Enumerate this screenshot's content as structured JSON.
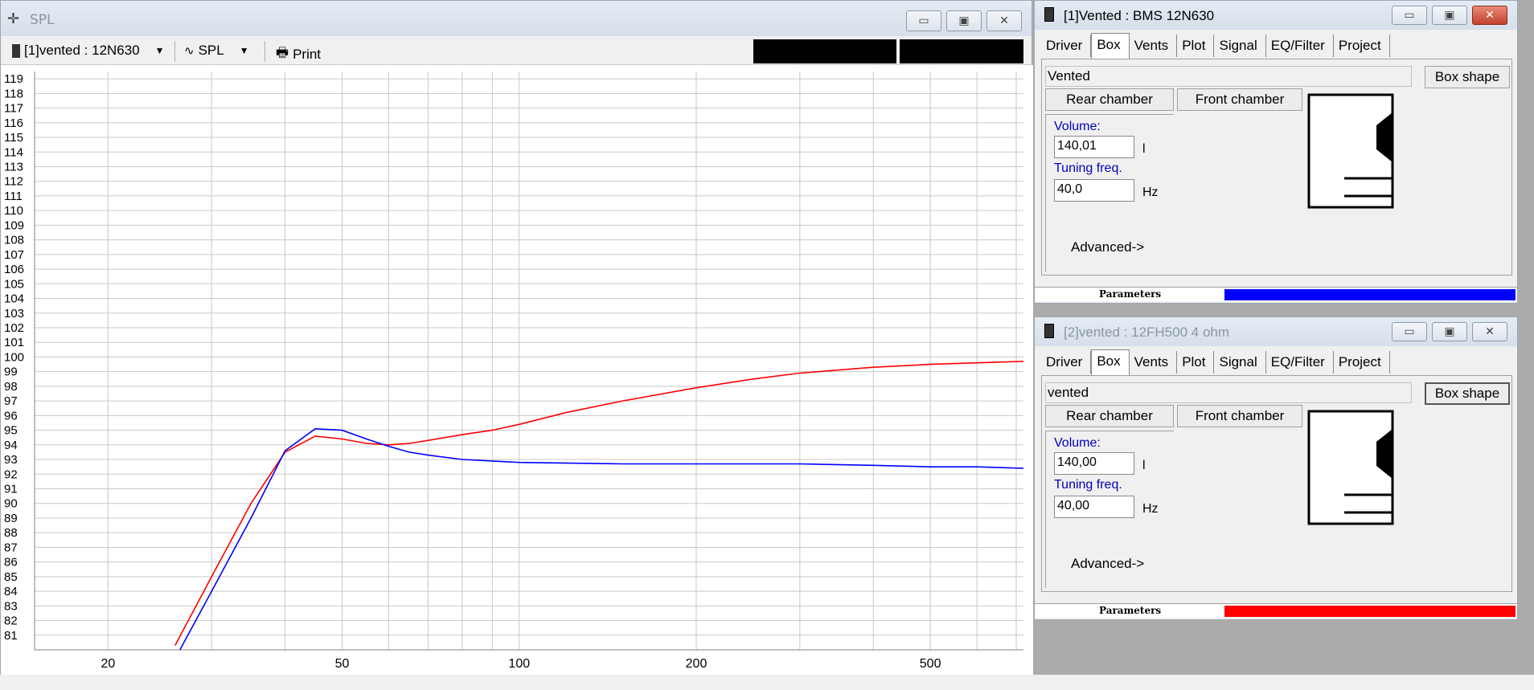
{
  "spl_window": {
    "title": "SPL",
    "toolbar": {
      "driver_select": "[1]vented : 12N630",
      "graph_select": "SPL",
      "print_label": "Print"
    }
  },
  "chart_data": {
    "type": "line",
    "xscale": "log",
    "xlim": [
      15,
      720
    ],
    "ylim": [
      80,
      119.5
    ],
    "x_tick_labels": [
      "20",
      "50",
      "100",
      "200",
      "500"
    ],
    "x_ticks": [
      20,
      50,
      100,
      200,
      500
    ],
    "y_tick_labels": [
      "81",
      "82",
      "83",
      "84",
      "85",
      "86",
      "87",
      "88",
      "89",
      "90",
      "91",
      "92",
      "93",
      "94",
      "95",
      "96",
      "97",
      "98",
      "99",
      "100",
      "101",
      "102",
      "103",
      "104",
      "105",
      "106",
      "107",
      "108",
      "109",
      "110",
      "111",
      "112",
      "113",
      "114",
      "115",
      "116",
      "117",
      "118",
      "119"
    ],
    "grid": true,
    "series": [
      {
        "color": "#ff0000",
        "x": [
          26,
          30,
          35,
          40,
          45,
          50,
          55,
          60,
          65,
          70,
          80,
          90,
          100,
          120,
          150,
          200,
          250,
          300,
          400,
          500,
          600,
          720
        ],
        "y": [
          80.3,
          85.0,
          90.0,
          93.5,
          94.6,
          94.4,
          94.1,
          94.0,
          94.1,
          94.3,
          94.7,
          95.0,
          95.4,
          96.2,
          97.0,
          97.9,
          98.5,
          98.9,
          99.3,
          99.5,
          99.6,
          99.7
        ]
      },
      {
        "color": "#0000ff",
        "x": [
          26.5,
          30,
          35,
          40,
          45,
          50,
          55,
          60,
          65,
          70,
          80,
          90,
          100,
          150,
          200,
          300,
          400,
          500,
          600,
          720
        ],
        "y": [
          80.0,
          84.0,
          89.0,
          93.6,
          95.1,
          95.0,
          94.4,
          93.9,
          93.5,
          93.3,
          93.0,
          92.9,
          92.8,
          92.7,
          92.7,
          92.7,
          92.6,
          92.5,
          92.5,
          92.4
        ]
      }
    ]
  },
  "panel1": {
    "title": "[1]Vented : BMS 12N630",
    "tabs": [
      "Driver",
      "Box",
      "Vents",
      "Plot",
      "Signal",
      "EQ/Filter",
      "Project"
    ],
    "box_name": "Vented",
    "box_shape_label": "Box shape",
    "rear_chamber_label": "Rear chamber",
    "front_chamber_label": "Front chamber",
    "volume_label": "Volume:",
    "volume_value": "140,01",
    "volume_unit": "l",
    "tuning_label": "Tuning freq.",
    "tuning_value": "40,0",
    "tuning_unit": "Hz",
    "advanced_label": "Advanced->",
    "parameters_label": "Parameters",
    "color": "#0000ff"
  },
  "panel2": {
    "title": "[2]vented :  12FH500 4 ohm",
    "tabs": [
      "Driver",
      "Box",
      "Vents",
      "Plot",
      "Signal",
      "EQ/Filter",
      "Project"
    ],
    "box_name": "vented",
    "box_shape_label": "Box shape",
    "rear_chamber_label": "Rear chamber",
    "front_chamber_label": "Front chamber",
    "volume_label": "Volume:",
    "volume_value": "140,00",
    "volume_unit": "l",
    "tuning_label": "Tuning freq.",
    "tuning_value": "40,00",
    "tuning_unit": "Hz",
    "advanced_label": "Advanced->",
    "parameters_label": "Parameters",
    "color": "#ff0000"
  }
}
